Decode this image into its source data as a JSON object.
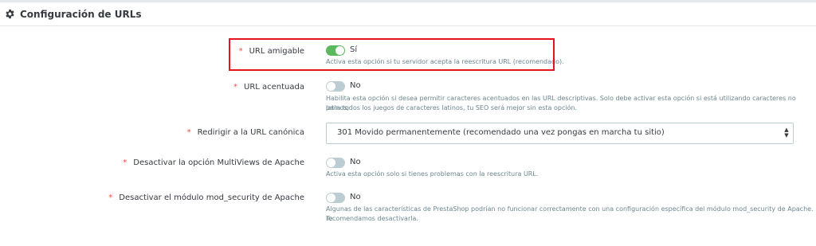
{
  "panel": {
    "title": "Configuración de URLs",
    "icon": "gear-icon"
  },
  "colors": {
    "accent_on": "#5cb85c",
    "switch_off": "#bbcdd2",
    "required_star": "#f54c3e",
    "highlight_box": "#e3141c"
  },
  "fields": {
    "friendly_url": {
      "required": "*",
      "label": "URL amigable",
      "value": "Sí",
      "enabled": true,
      "help": "Activa esta opción si tu servidor acepta la reescritura URL (recomendado)."
    },
    "accented_url": {
      "required": "*",
      "label": "URL acentuada",
      "value": "No",
      "enabled": false,
      "help_line1": "Habilita esta opción si desea permitir caracteres acentuados en las URL descriptivas. Solo debe activar esta opción si está utilizando caracteres no latinos;",
      "help_line2": "para todos los juegos de caracteres latinos, tu SEO será mejor sin esta opción."
    },
    "canonical_redirect": {
      "required": "*",
      "label": "Redirigir a la URL canónica",
      "selected": "301 Movido permanentemente (recomendado una vez pongas en marcha tu sitio)"
    },
    "multiviews": {
      "required": "*",
      "label": "Desactivar la opción MultiViews de Apache",
      "value": "No",
      "enabled": false,
      "help": "Activa esta opción solo si tienes problemas con la reescritura URL."
    },
    "mod_security": {
      "required": "*",
      "label": "Desactivar el módulo mod_security de Apache",
      "value": "No",
      "enabled": false,
      "help_line1": "Algunas de las características de PrestaShop podrían no funcionar correctamente con una configuración específica del módulo mod_security de Apache. Te",
      "help_line2": "recomendamos desactivarla."
    }
  }
}
